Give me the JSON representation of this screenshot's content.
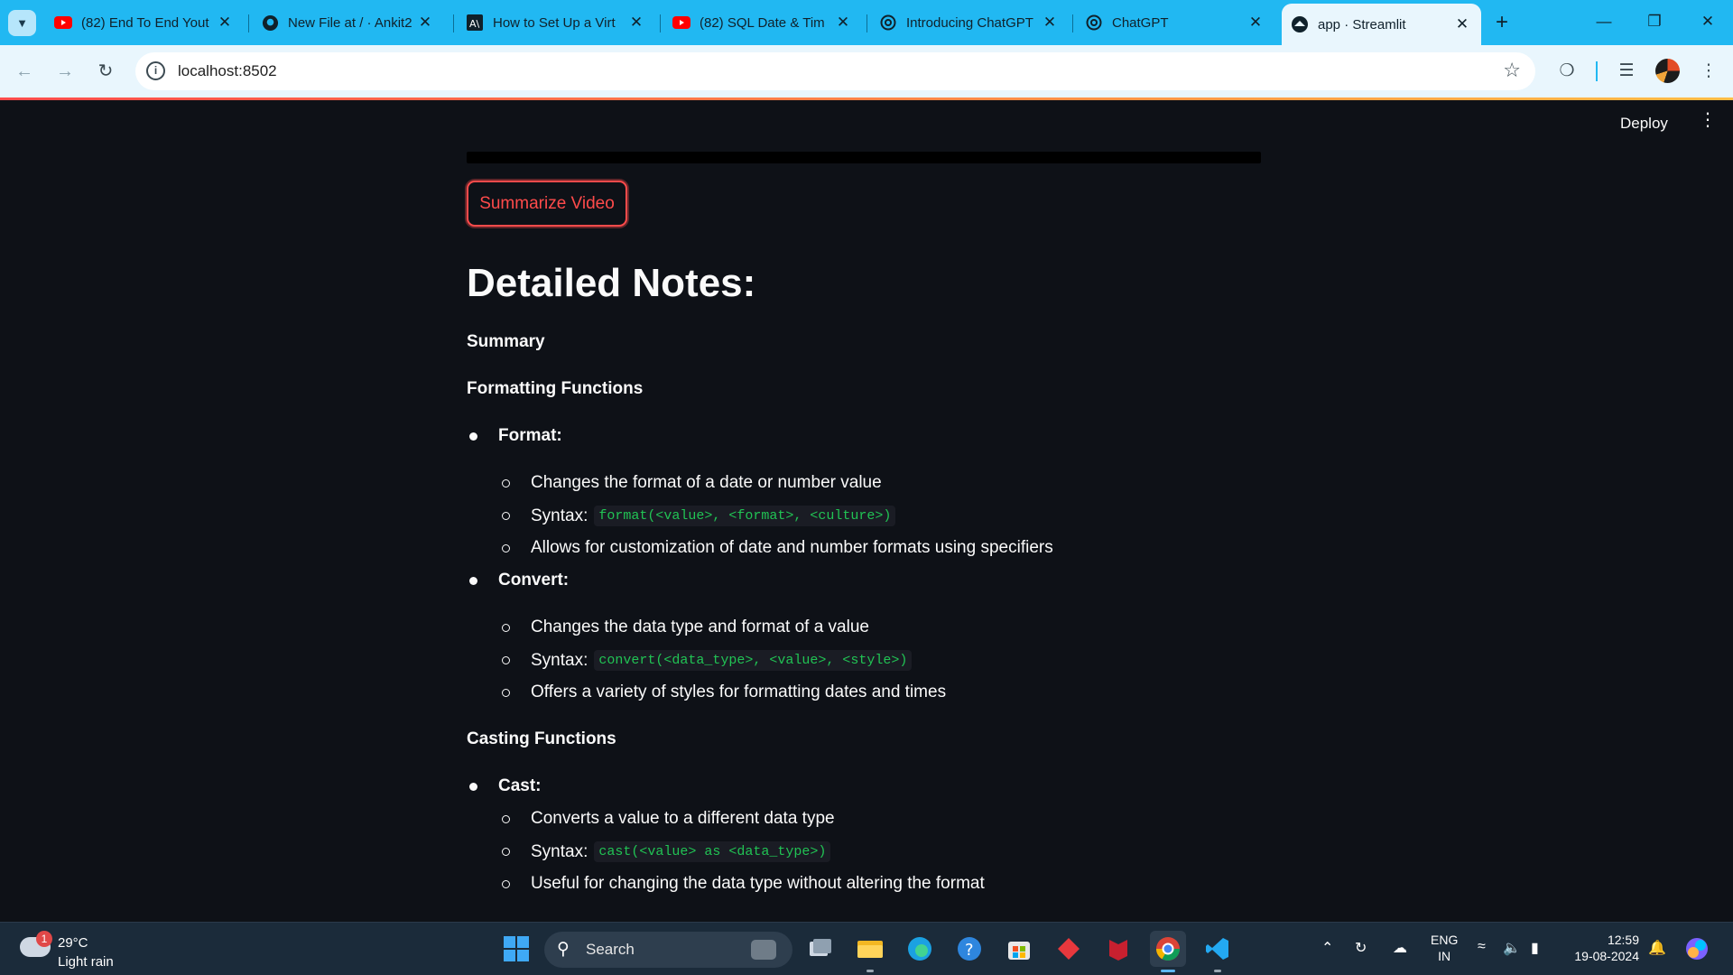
{
  "browser": {
    "tabs": [
      {
        "title": "(82) End To End Yout",
        "favicon": "youtube-icon"
      },
      {
        "title": "New File at / · Ankit2",
        "favicon": "github-icon"
      },
      {
        "title": "How to Set Up a Virt",
        "favicon": "article-icon"
      },
      {
        "title": "(82) SQL Date & Tim",
        "favicon": "youtube-icon"
      },
      {
        "title": "Introducing ChatGPT",
        "favicon": "openai-icon"
      },
      {
        "title": "ChatGPT",
        "favicon": "openai-icon"
      },
      {
        "title": "app · Streamlit",
        "favicon": "streamlit-icon",
        "active": true
      }
    ],
    "url": "localhost:8502"
  },
  "app": {
    "deploy_label": "Deploy",
    "button_label": "Summarize Video",
    "heading": "Detailed Notes:",
    "summary_label": "Summary",
    "sections": [
      {
        "title": "Formatting Functions",
        "items": [
          {
            "name": "Format:",
            "points": [
              {
                "text": "Changes the format of a date or number value"
              },
              {
                "text": "Syntax:",
                "code": "format(<value>, <format>, <culture>)"
              },
              {
                "text": "Allows for customization of date and number formats using specifiers"
              }
            ]
          },
          {
            "name": "Convert:",
            "points": [
              {
                "text": "Changes the data type and format of a value"
              },
              {
                "text": "Syntax:",
                "code": "convert(<data_type>, <value>, <style>)"
              },
              {
                "text": "Offers a variety of styles for formatting dates and times"
              }
            ]
          }
        ]
      },
      {
        "title": "Casting Functions",
        "items": [
          {
            "name": "Cast:",
            "points": [
              {
                "text": "Converts a value to a different data type"
              },
              {
                "text": "Syntax:",
                "code": "cast(<value> as <data_type>)"
              },
              {
                "text": "Useful for changing the data type without altering the format"
              }
            ]
          }
        ]
      }
    ]
  },
  "taskbar": {
    "weather_temp": "29°C",
    "weather_desc": "Light rain",
    "weather_badge": "1",
    "search_label": "Search",
    "lang_top": "ENG",
    "lang_bottom": "IN",
    "time": "12:59",
    "date": "19-08-2024"
  },
  "colors": {
    "accent": "#ff4b4b",
    "code_text": "#21c354",
    "background": "#0e1117",
    "tabstrip": "#21b8f2"
  }
}
